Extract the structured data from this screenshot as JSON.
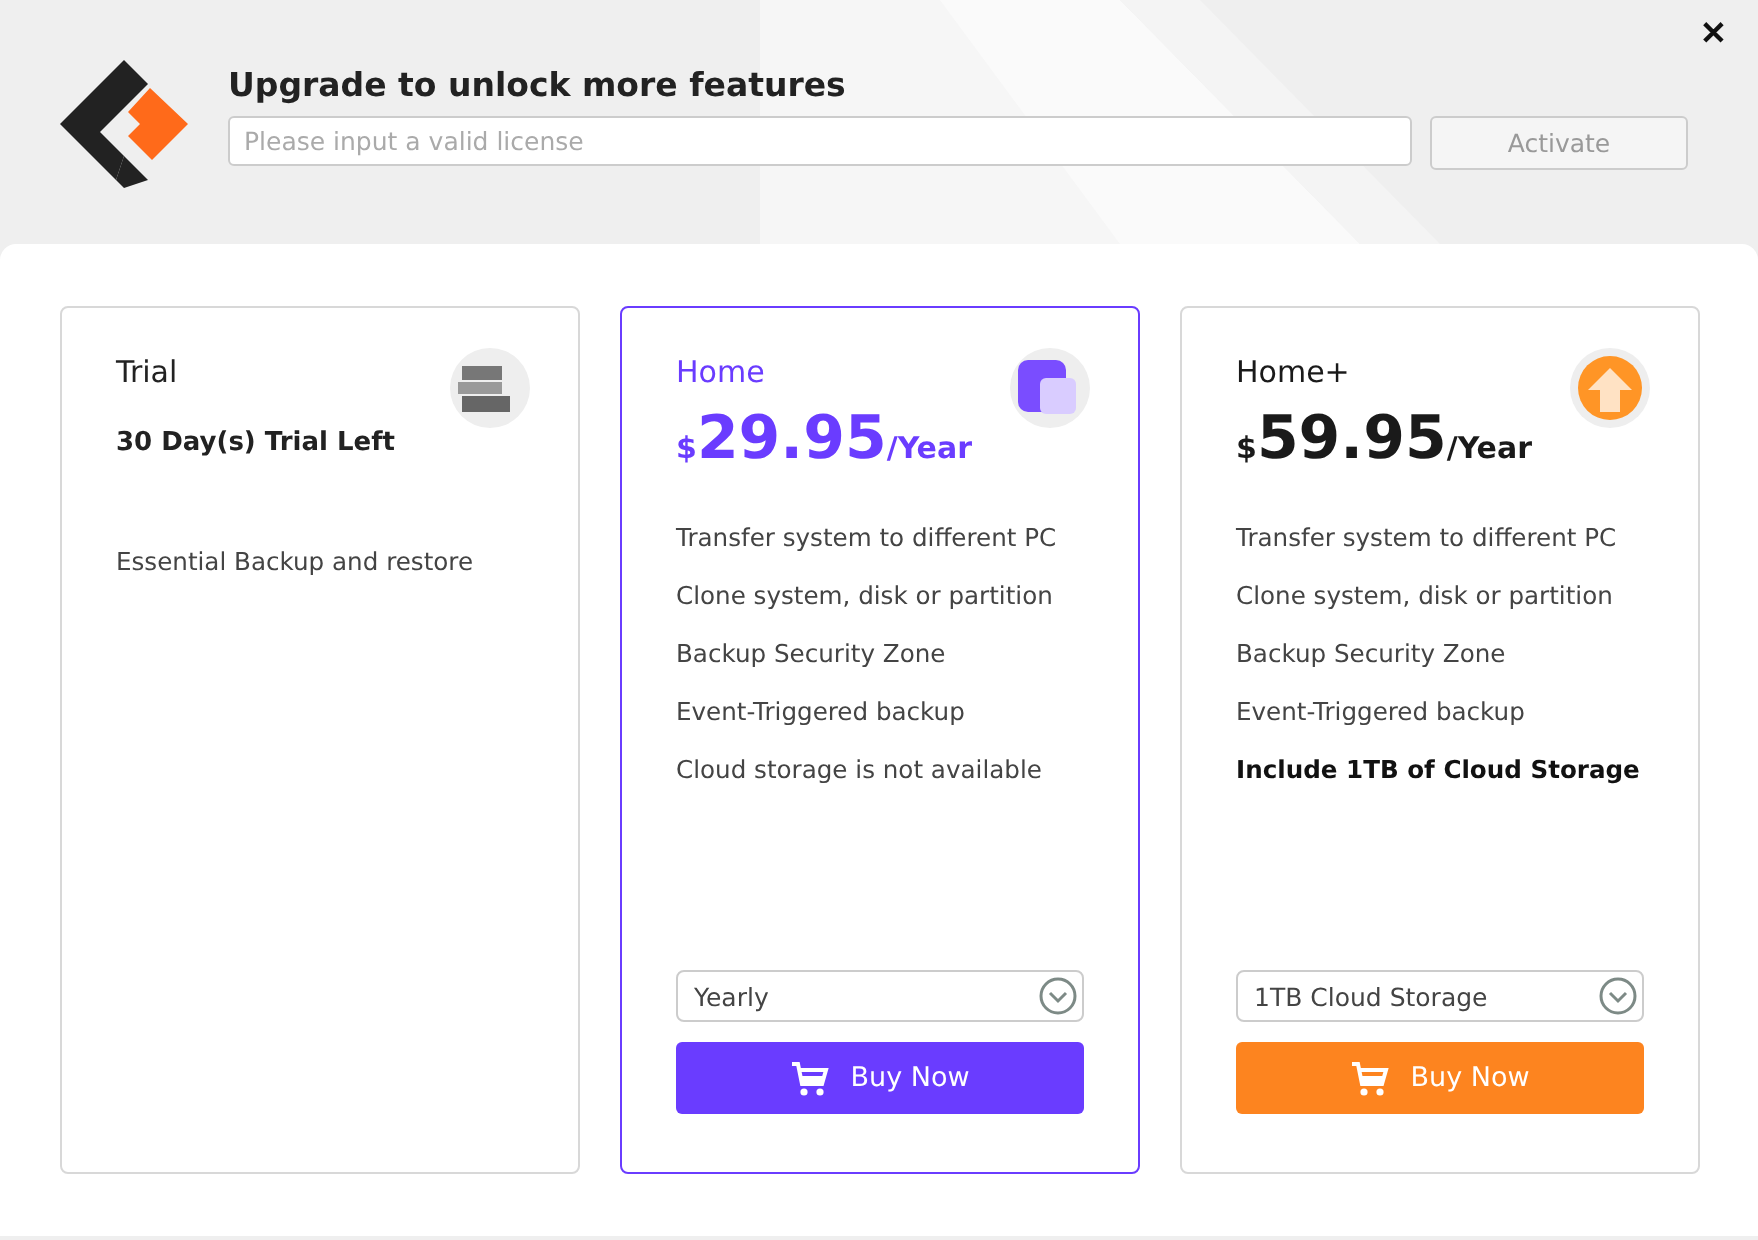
{
  "header": {
    "title": "Upgrade to unlock more features",
    "license_field": {
      "placeholder": "Please input a valid license"
    },
    "activate_button": {
      "label": "Activate",
      "disabled": true
    },
    "close": "✕"
  },
  "plans": [
    {
      "kind": "trial",
      "name": "Trial",
      "selected": false,
      "color": "#222222",
      "subtitle": "30 Day(s) Trial Left",
      "features": [
        {
          "text": "Essential Backup and restore",
          "bold": false
        }
      ]
    },
    {
      "kind": "home",
      "name": "Home",
      "selected": true,
      "color": "#6a3cff",
      "price": {
        "currency": "$",
        "amount": "29.95",
        "period": "/Year"
      },
      "features": [
        {
          "text": "Transfer system to different PC",
          "bold": false
        },
        {
          "text": "Clone system, disk or partition",
          "bold": false
        },
        {
          "text": "Backup Security Zone",
          "bold": false
        },
        {
          "text": "Event-Triggered backup",
          "bold": false
        },
        {
          "text": "Cloud storage is not available",
          "bold": false
        }
      ],
      "dropdown": "Yearly",
      "buy_button": {
        "label": "Buy Now",
        "color": "#6a3cff"
      }
    },
    {
      "kind": "homeplus",
      "name": "Home+",
      "selected": false,
      "color": "#1a1a1a",
      "price": {
        "currency": "$",
        "amount": "59.95",
        "period": "/Year"
      },
      "features": [
        {
          "text": "Transfer system to different PC",
          "bold": false
        },
        {
          "text": "Clone system, disk or partition",
          "bold": false
        },
        {
          "text": "Backup Security Zone",
          "bold": false
        },
        {
          "text": "Event-Triggered backup",
          "bold": false
        },
        {
          "text": "Include 1TB of Cloud Storage",
          "bold": true
        }
      ],
      "dropdown": "1TB Cloud Storage",
      "buy_button": {
        "label": "Buy Now",
        "color": "#fd841f"
      }
    }
  ]
}
